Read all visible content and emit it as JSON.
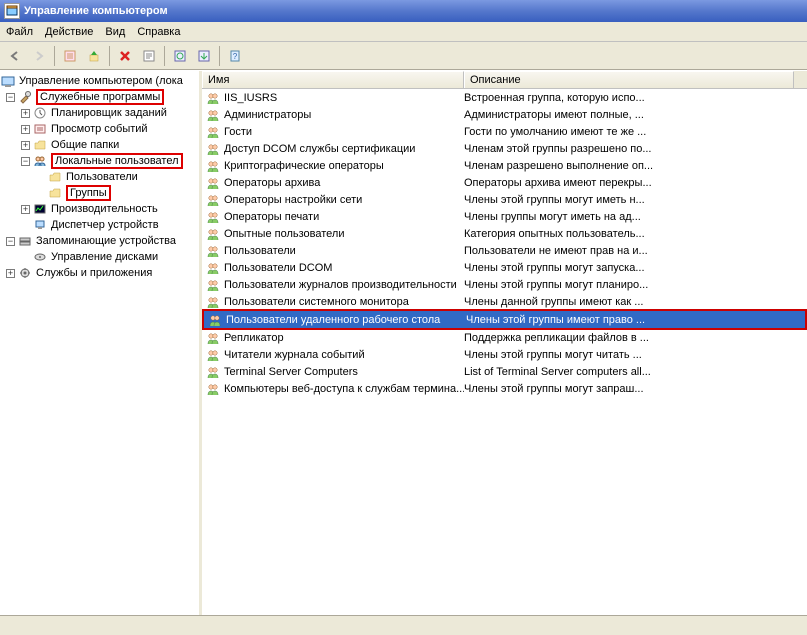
{
  "window": {
    "title": "Управление компьютером"
  },
  "menu": {
    "file": "Файл",
    "action": "Действие",
    "view": "Вид",
    "help": "Справка"
  },
  "tree": {
    "root": "Управление компьютером (лока",
    "utilities": "Служебные программы",
    "task_scheduler": "Планировщик заданий",
    "event_viewer": "Просмотр событий",
    "shared_folders": "Общие папки",
    "local_users": "Локальные пользовател",
    "users": "Пользователи",
    "groups": "Группы",
    "performance": "Производительность",
    "devmgr": "Диспетчер устройств",
    "storage": "Запоминающие устройства",
    "diskmgr": "Управление дисками",
    "services": "Службы и приложения"
  },
  "list": {
    "col_name": "Имя",
    "col_desc": "Описание",
    "rows": [
      {
        "name": "IIS_IUSRS",
        "desc": "Встроенная группа, которую испо..."
      },
      {
        "name": "Администраторы",
        "desc": "Администраторы имеют полные, ..."
      },
      {
        "name": "Гости",
        "desc": "Гости по умолчанию имеют те же ..."
      },
      {
        "name": "Доступ DCOM службы сертификации",
        "desc": "Членам этой группы разрешено по..."
      },
      {
        "name": "Криптографические операторы",
        "desc": "Членам разрешено выполнение оп..."
      },
      {
        "name": "Операторы архива",
        "desc": "Операторы архива имеют перекры..."
      },
      {
        "name": "Операторы настройки сети",
        "desc": "Члены этой группы могут иметь н..."
      },
      {
        "name": "Операторы печати",
        "desc": "Члены группы могут иметь на ад..."
      },
      {
        "name": "Опытные пользователи",
        "desc": "Категория опытных пользователь..."
      },
      {
        "name": "Пользователи",
        "desc": "Пользователи не имеют прав на и..."
      },
      {
        "name": "Пользователи DCOM",
        "desc": "Члены этой группы могут запуска..."
      },
      {
        "name": "Пользователи журналов производительности",
        "desc": "Члены этой группы могут планиро..."
      },
      {
        "name": "Пользователи системного монитора",
        "desc": "Члены данной группы имеют как ..."
      },
      {
        "name": "Пользователи удаленного рабочего стола",
        "desc": "Члены этой группы имеют право ..."
      },
      {
        "name": "Репликатор",
        "desc": "Поддержка репликации файлов в ..."
      },
      {
        "name": "Читатели журнала событий",
        "desc": "Члены этой группы могут читать ..."
      },
      {
        "name": "Terminal Server Computers",
        "desc": "List of Terminal Server computers all..."
      },
      {
        "name": "Компьютеры веб-доступа к службам термина...",
        "desc": "Члены этой группы могут запраш..."
      }
    ],
    "selected_index": 13
  },
  "status": ""
}
